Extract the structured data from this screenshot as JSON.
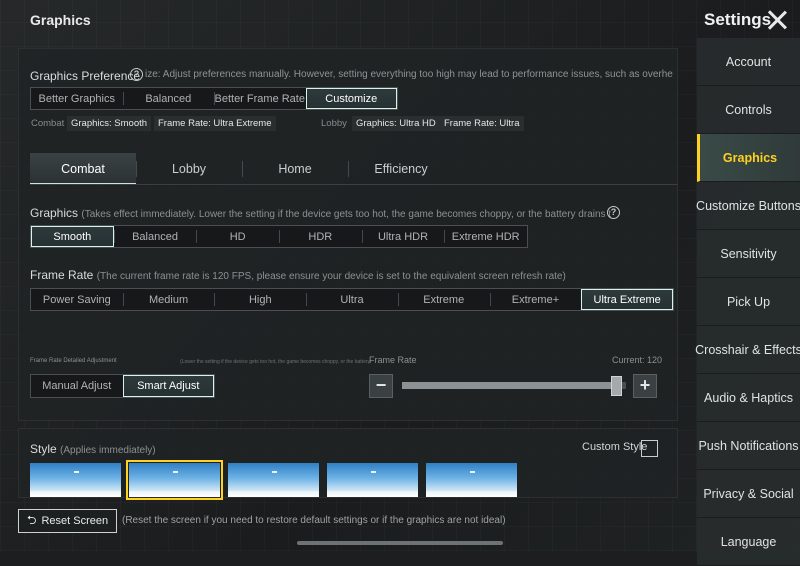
{
  "header": {
    "title": "Graphics",
    "settings_title": "Settings"
  },
  "preference": {
    "label": "Graphics Preference",
    "description": "ize: Adjust preferences manually. However, setting everything too high may lead to performance issues, such as overheating, b",
    "options": [
      "Better Graphics",
      "Balanced",
      "Better Frame Rate",
      "Customize"
    ],
    "selected": "Customize",
    "combat_label": "Combat",
    "combat_graphics": "Graphics: Smooth",
    "combat_frame_rate": "Frame Rate: Ultra Extreme",
    "lobby_label": "Lobby",
    "lobby_graphics": "Graphics: Ultra HD",
    "lobby_frame_rate": "Frame Rate: Ultra"
  },
  "tabs": {
    "items": [
      "Combat",
      "Lobby",
      "Home",
      "Efficiency"
    ],
    "selected": "Combat"
  },
  "graphics": {
    "label": "Graphics",
    "hint": "(Takes effect immediately. Lower the setting if the device gets too hot, the game becomes choppy, or the battery drains too quickly.)",
    "options": [
      "Smooth",
      "Balanced",
      "HD",
      "HDR",
      "Ultra HDR",
      "Extreme HDR"
    ],
    "selected": "Smooth"
  },
  "frame_rate": {
    "label": "Frame Rate",
    "hint": "(The current frame rate is 120 FPS, please ensure your device is set to the equivalent screen refresh rate)",
    "options": [
      "Power Saving",
      "Medium",
      "High",
      "Ultra",
      "Extreme",
      "Extreme+",
      "Ultra Extreme"
    ],
    "selected": "Ultra Extreme"
  },
  "frame_rate_adjust": {
    "label": "Frame Rate Detailed Adjustment",
    "hint": "(Lower the setting if the device gets too hot, the game becomes choppy, or the battery",
    "options": [
      "Manual Adjust",
      "Smart Adjust"
    ],
    "selected": "Smart Adjust",
    "slider_title": "Frame Rate",
    "current": "Current: 120",
    "slider_fraction": 0.98
  },
  "style": {
    "label": "Style",
    "hint": "(Applies immediately)",
    "custom_label": "Custom Style",
    "custom_checked": false,
    "thumbnails_count": 5,
    "selected_index": 1
  },
  "footer": {
    "reset_label": "Reset Screen",
    "reset_note": "(Reset the screen if you need to restore default settings or if the graphics are not ideal)"
  },
  "sidebar": {
    "items": [
      "Account",
      "Controls",
      "Graphics",
      "Customize Buttons",
      "Sensitivity",
      "Pick Up",
      "Crosshair & Effects",
      "Audio & Haptics",
      "Push Notifications",
      "Privacy & Social",
      "Language"
    ],
    "selected": "Graphics"
  },
  "colors": {
    "accent": "#ffd21f",
    "selected_outline": "#d9f2ec"
  }
}
